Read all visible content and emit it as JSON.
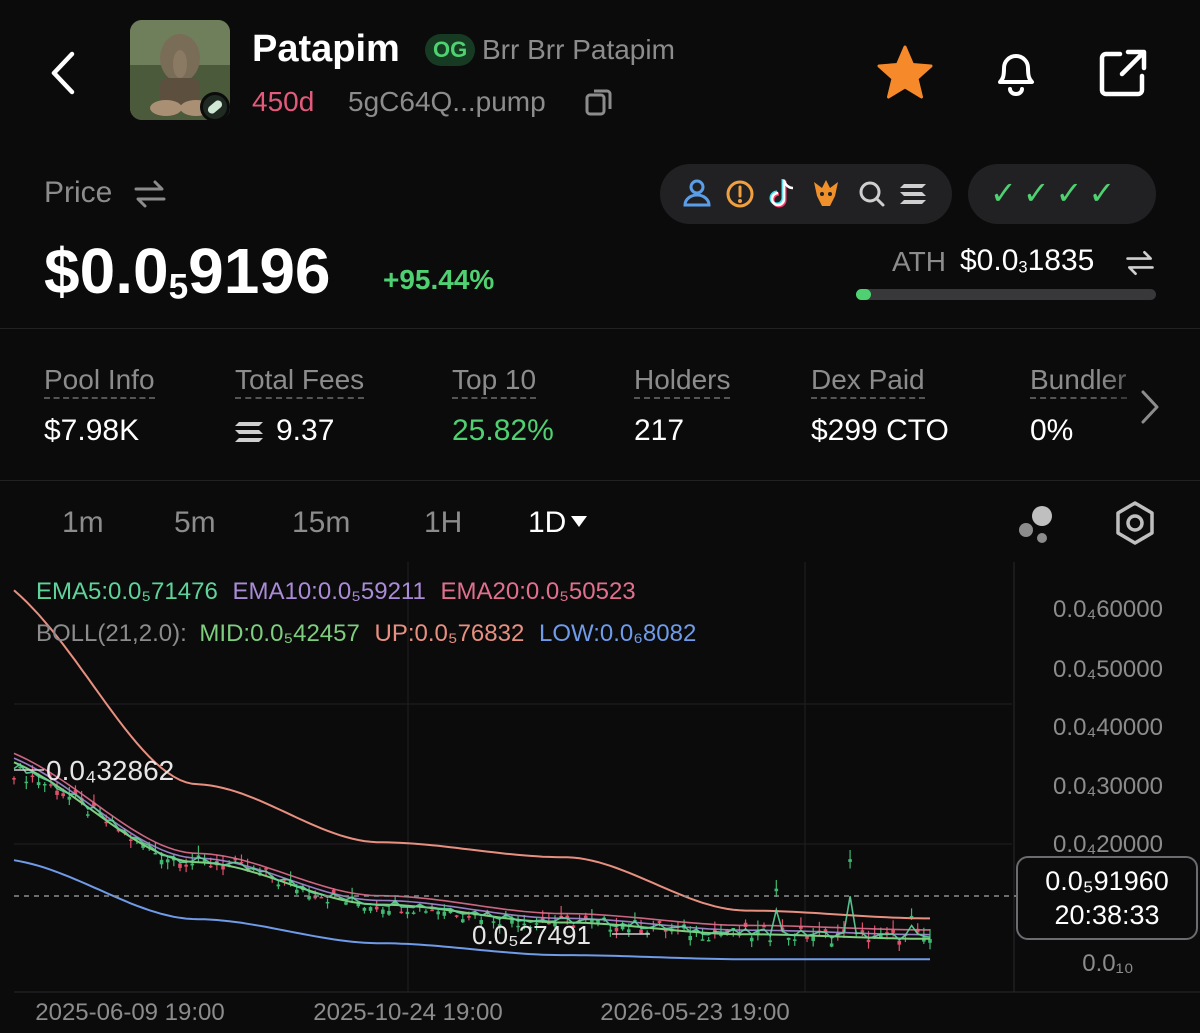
{
  "header": {
    "token_name": "Patapim",
    "og_badge": "OG",
    "full_name": "Brr Brr Patapim",
    "age": "450d",
    "address": "5gC64Q...pump"
  },
  "price": {
    "label": "Price",
    "prefix": "$0.0",
    "zeros": "5",
    "suffix": "9196",
    "change": "+95.44%",
    "ath_label": "ATH",
    "ath_prefix": "$0.0",
    "ath_zeros": "3",
    "ath_suffix": "1835",
    "ath_progress": 0.05
  },
  "social_icons": [
    "user-icon",
    "alert-icon",
    "tiktok-icon",
    "eagle-icon",
    "search-icon",
    "solana-icon"
  ],
  "checks": [
    "✓",
    "✓",
    "✓",
    "✓"
  ],
  "stats": [
    {
      "label": "Pool Info",
      "value": "$7.98K"
    },
    {
      "label": "Total Fees",
      "value": "9.37"
    },
    {
      "label": "Top 10",
      "value": "25.82%"
    },
    {
      "label": "Holders",
      "value": "217"
    },
    {
      "label": "Dex Paid",
      "value": "$299 CTO"
    },
    {
      "label": "Bundler",
      "value": "0%"
    }
  ],
  "timeframes": [
    "1m",
    "5m",
    "15m",
    "1H",
    "1D"
  ],
  "active_timeframe": "1D",
  "legend": {
    "ema5": "EMA5:0.0₅71476",
    "ema10": "EMA10:0.0₅59211",
    "ema20": "EMA20:0.0₅50523",
    "boll": "BOLL(21,2.0):",
    "mid": "MID:0.0₅42457",
    "up": "UP:0.0₅76832",
    "low": "LOW:0.0₆8082"
  },
  "colors": {
    "ema5": "#5fd39a",
    "ema10": "#a98bd6",
    "ema20": "#e0708e",
    "boll_mid": "#7fce7f",
    "boll_up": "#e89080",
    "boll_low": "#6f9be8",
    "up_candle": "#3fb870",
    "down_candle": "#e0506a",
    "accent_green": "#4fd071",
    "star": "#f68a2a"
  },
  "chart_data": {
    "type": "line",
    "y_axis_labels": [
      "0.0₄60000",
      "0.0₄50000",
      "0.0₄40000",
      "0.0₄30000",
      "0.0₄20000",
      "0.0₁₀"
    ],
    "x_axis_labels": [
      "2025-06-09 19:00",
      "2025-10-24 19:00",
      "2026-05-23 19:00"
    ],
    "high_label": "0.0₄32862",
    "low_label": "0.0₅27491",
    "current_price": "0.0₅91960",
    "countdown": "20:38:33",
    "series": [
      {
        "name": "UP",
        "values": [
          55000,
          30000,
          20500,
          18000,
          9000,
          7683
        ]
      },
      {
        "name": "MID",
        "values": [
          30000,
          17000,
          10000,
          7000,
          5000,
          4246
        ]
      },
      {
        "name": "LOW",
        "values": [
          16000,
          7500,
          3500,
          1500,
          800,
          808
        ]
      }
    ],
    "grid": true
  }
}
